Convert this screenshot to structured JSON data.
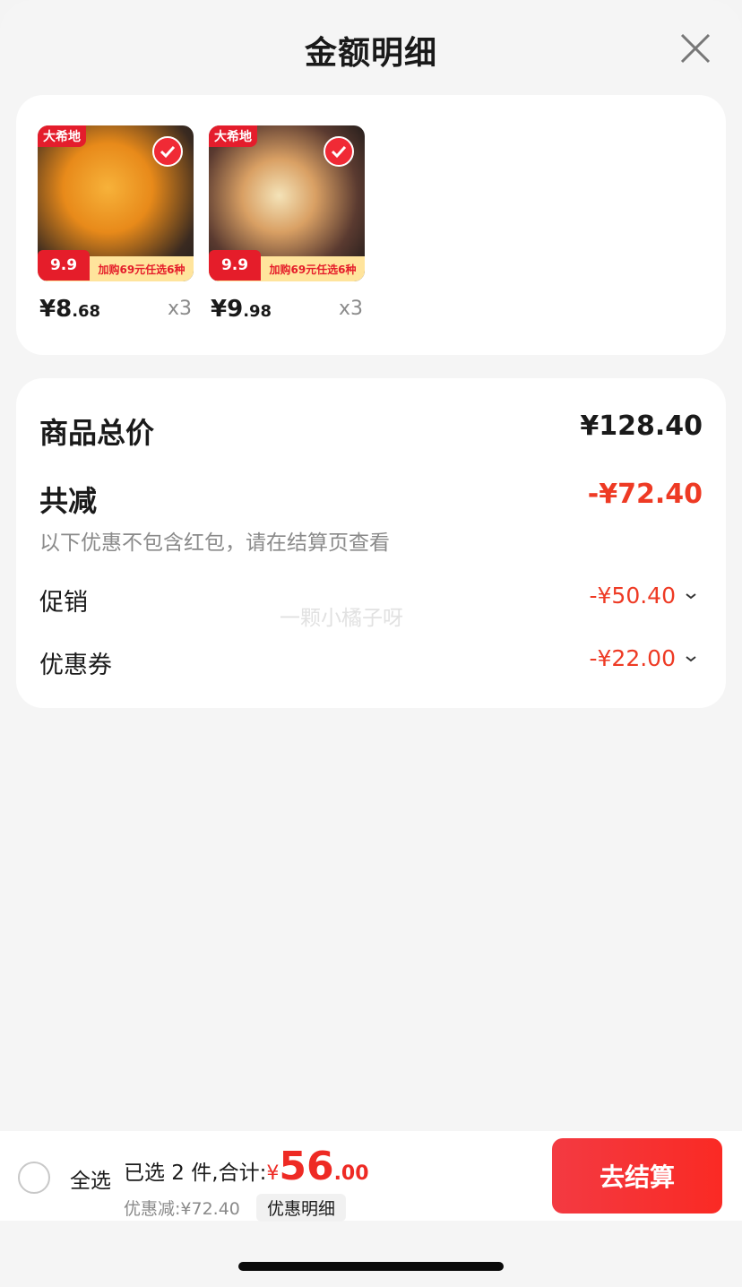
{
  "header": {
    "title": "金额明细",
    "close_icon": "close-icon"
  },
  "products": [
    {
      "brand": "大希地",
      "promo_price": "9.9",
      "promo_text": "加购69元任选6种",
      "price_int": "¥8",
      "price_dec": ".68",
      "qty": "x3"
    },
    {
      "brand": "大希地",
      "promo_price": "9.9",
      "promo_text": "加购69元任选6种",
      "price_int": "¥9",
      "price_dec": ".98",
      "qty": "x3"
    }
  ],
  "summary": {
    "total_label": "商品总价",
    "total_value": "¥128.40",
    "reduce_label": "共减",
    "reduce_value": "-¥72.40",
    "note": "以下优惠不包含红包，请在结算页查看",
    "promo_label": "促销",
    "promo_value": "-¥50.40",
    "coupon_label": "优惠券",
    "coupon_value": "-¥22.00"
  },
  "watermark": "一颗小橘子呀",
  "bottom": {
    "select_all": "全选",
    "selected_text": "已选 2 件,合计:",
    "currency": "¥",
    "total_int": "56",
    "total_dec": ".00",
    "discount_text": "优惠减:¥72.40",
    "detail_button": "优惠明细",
    "checkout_button": "去结算"
  },
  "colors": {
    "accent_red": "#ee3a24",
    "checkout_red": "#f33a42"
  }
}
